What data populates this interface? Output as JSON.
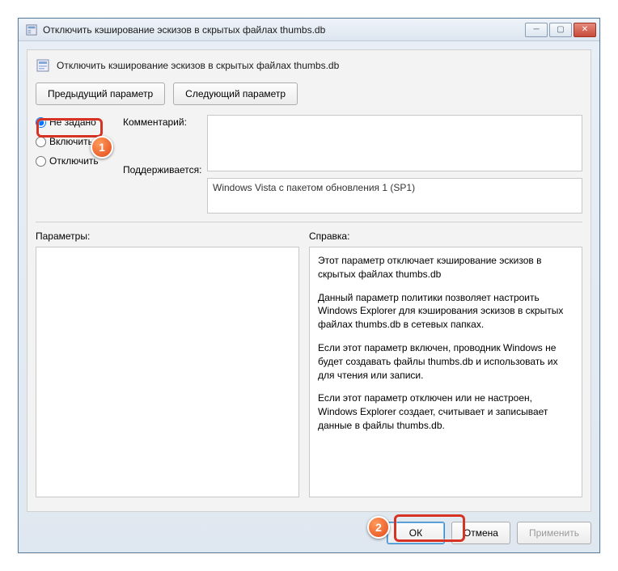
{
  "window": {
    "title": "Отключить кэширование эскизов в скрытых файлах thumbs.db"
  },
  "header": {
    "title": "Отключить кэширование эскизов в скрытых файлах thumbs.db"
  },
  "nav": {
    "prev": "Предыдущий параметр",
    "next": "Следующий параметр"
  },
  "radios": {
    "not_configured": "Не задано",
    "enabled": "Включить",
    "disabled": "Отключить"
  },
  "labels": {
    "comment": "Комментарий:",
    "supported": "Поддерживается:",
    "options": "Параметры:",
    "help": "Справка:"
  },
  "supported_text": "Windows Vista с пакетом обновления 1 (SP1)",
  "help": {
    "p1": "Этот параметр отключает кэширование эскизов в скрытых файлах thumbs.db",
    "p2": "Данный параметр политики позволяет настроить Windows Explorer для кэширования эскизов в скрытых файлах thumbs.db в сетевых папках.",
    "p3": "Если этот параметр включен, проводник Windows не будет создавать файлы thumbs.db и использовать их для чтения или записи.",
    "p4": "Если этот параметр отключен или не настроен, Windows Explorer создает, считывает и записывает данные в файлы thumbs.db."
  },
  "footer": {
    "ok": "ОК",
    "cancel": "Отмена",
    "apply": "Применить"
  },
  "annotations": {
    "badge1": "1",
    "badge2": "2"
  }
}
